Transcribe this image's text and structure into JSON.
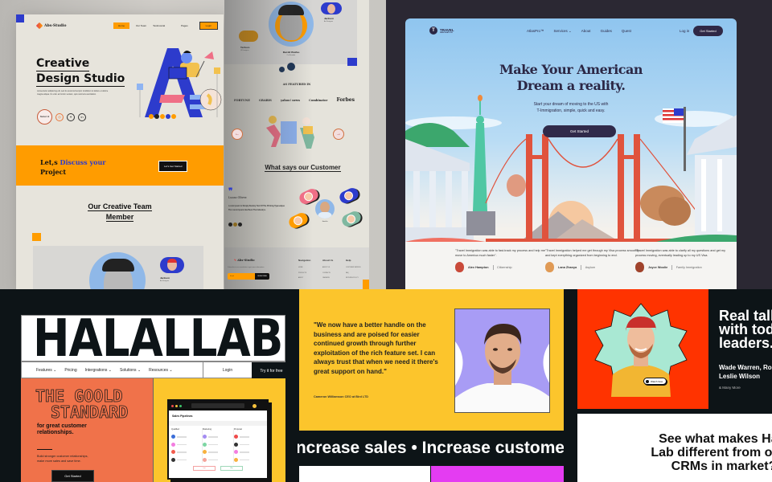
{
  "abs_studio": {
    "brand": "Abs-Studio",
    "nav": {
      "home": "Home",
      "team": "Our Team",
      "testimonial": "Testimonial",
      "pages": "Pages",
      "login": "Login"
    },
    "hero": {
      "title_line1": "Creative",
      "title_line2": "Design Studio",
      "description": "consectetur adipiscing elit, sed do eiusmod tempor incididunt ut labore et dolore magna aliqua. Ut enim ad minim veniam, quis nostrud exercitation.",
      "badge": "Started 12",
      "social": [
        "instagram",
        "twitter",
        "linkedin"
      ],
      "dot_colors": [
        "#ff9c00",
        "#222222",
        "#ff9c00",
        "#2d3bcc",
        "#ff9c00"
      ]
    },
    "cta_band": {
      "text_plain": "Let,s",
      "text_highlight": "Discuss your",
      "text_line2": "Project",
      "button": "Let's Get Started"
    },
    "team": {
      "title_line1": "Our Creative Team",
      "title_line2": "Member",
      "members": [
        {
          "name": "Jackson",
          "role": "Art Designer"
        },
        {
          "name": "David Burke",
          "role": "Co-Founder"
        },
        {
          "name": "Teriluvo",
          "role": "UI Designer"
        }
      ]
    },
    "featured": {
      "title": "AS FEATURED IN",
      "logos": [
        "FORTUNE",
        "GRABIS",
        "yahoo! news",
        "Combinator",
        "Forbes"
      ]
    },
    "testimonials": {
      "title": "What says our Customer",
      "name": "Lucas Oliver.",
      "quote": "Lorem Ipsum Is Simply Dummy Text Of The Printing Typesetque The Lorem Ipsum Has Been The Industrys.",
      "center_person": "Jennifer",
      "pill_colors": [
        "#ef6f86",
        "#2d3bcc",
        "#ff9c00",
        "#7fb8a0"
      ]
    },
    "footer": {
      "brand": "Abs-Studio",
      "description": "Subscribe to our newsletter to get more information",
      "email_placeholder": "Email",
      "subscribe": "SUBSCRIBE",
      "columns": [
        {
          "title": "Navigation",
          "links": [
            "HOME",
            "PRODUCTS",
            "ABOUT"
          ]
        },
        {
          "title": "About Us",
          "links": [
            "ABOUT US",
            "CONTACTS",
            "CAREERS"
          ]
        },
        {
          "title": "Help",
          "links": [
            "CUSTOMER SERVICE",
            "FAQ",
            "RETURNS POLICY"
          ]
        }
      ]
    }
  },
  "travel": {
    "brand": "TRAVEL",
    "brand_sub": "IMMIGRATION",
    "nav": [
      "AtlasPro™",
      "Services ⌄",
      "About",
      "Guides",
      "Quest"
    ],
    "login": "Log in",
    "get_started_nav": "Get Started",
    "title_line1": "Make Your American",
    "title_line2": "Dream a reality.",
    "subtitle_line1": "Start your dream of moving to the US with",
    "subtitle_line2": "T-Immigration, simple, quick and easy.",
    "cta": "Get Started",
    "testimonials": [
      {
        "quote": "\"Travel Immigration was able to fast-track my process and help me move to America much faster\".",
        "name": "Alex Hampton",
        "category": "Citizenship",
        "avatar_color": "#c94a3a"
      },
      {
        "quote": "\"Travel Immigration helped me get through my Visa process smoothly and kept everything organized from beginning to end.",
        "name": "Lana Zhanya",
        "category": "Asylum",
        "avatar_color": "#e09a55"
      },
      {
        "quote": "\"Travel Immigration was able to clarify all my questions and get my process moving, eventually leading up to my US Visa.",
        "name": "Joyce Woolie",
        "category": "Family Immigration",
        "avatar_color": "#a0432c"
      }
    ]
  },
  "halalab": {
    "logo": "HALALLAB",
    "nav": [
      "Features ⌄",
      "Pricing",
      "Intergrations ⌄",
      "Solutions ⌄",
      "Resources ⌄"
    ],
    "login": "Login",
    "try_free": "Try it for free",
    "headline_line1": "THE GOOLD",
    "headline_line2": "STANDARD",
    "sub_line1": "for great customer",
    "sub_line2": "relationships.",
    "desc_line1": "Build stronger customer relationships,",
    "desc_line2": "make more sales and save time.",
    "get_started": "Get Started",
    "app": {
      "title": "Sales Pipelines",
      "columns": [
        {
          "title": "Qualified",
          "colors": [
            "#3b6ed8",
            "#f37de0",
            "#f25b4d",
            "#333333"
          ]
        },
        {
          "title": "Marketing",
          "colors": [
            "#a48cf2",
            "#7dd6a3",
            "#f7b13d",
            "#f4a39a"
          ]
        },
        {
          "title": "Proposal",
          "colors": [
            "#ef4b4b",
            "#333333",
            "#f37de0",
            "#f7b13d"
          ]
        }
      ],
      "btn_lost": "Lost",
      "btn_won": "Won"
    }
  },
  "testimonial_card": {
    "quote": "\"We now have a better handle on the business and are poised for easier continued growth through further exploitation of the rich feature set. I can always trust that when we need it there's great support on hand.\"",
    "author": "Cameron Williamson CEO at Bird LTD",
    "marquee": "Increase sales  •  Increase customer"
  },
  "real_talk": {
    "title_line1": "Real talk",
    "title_line2": "with today's",
    "title_line3": "leaders.",
    "names_line1": "Wade Warren, Robert Fox,",
    "names_line2": "Leslie Wilson",
    "more": "& Many More",
    "watch": "Watch Now",
    "cta_line1": "See what makes Hala",
    "cta_line2": "Lab different from other",
    "cta_line3": "CRMs in market?"
  }
}
